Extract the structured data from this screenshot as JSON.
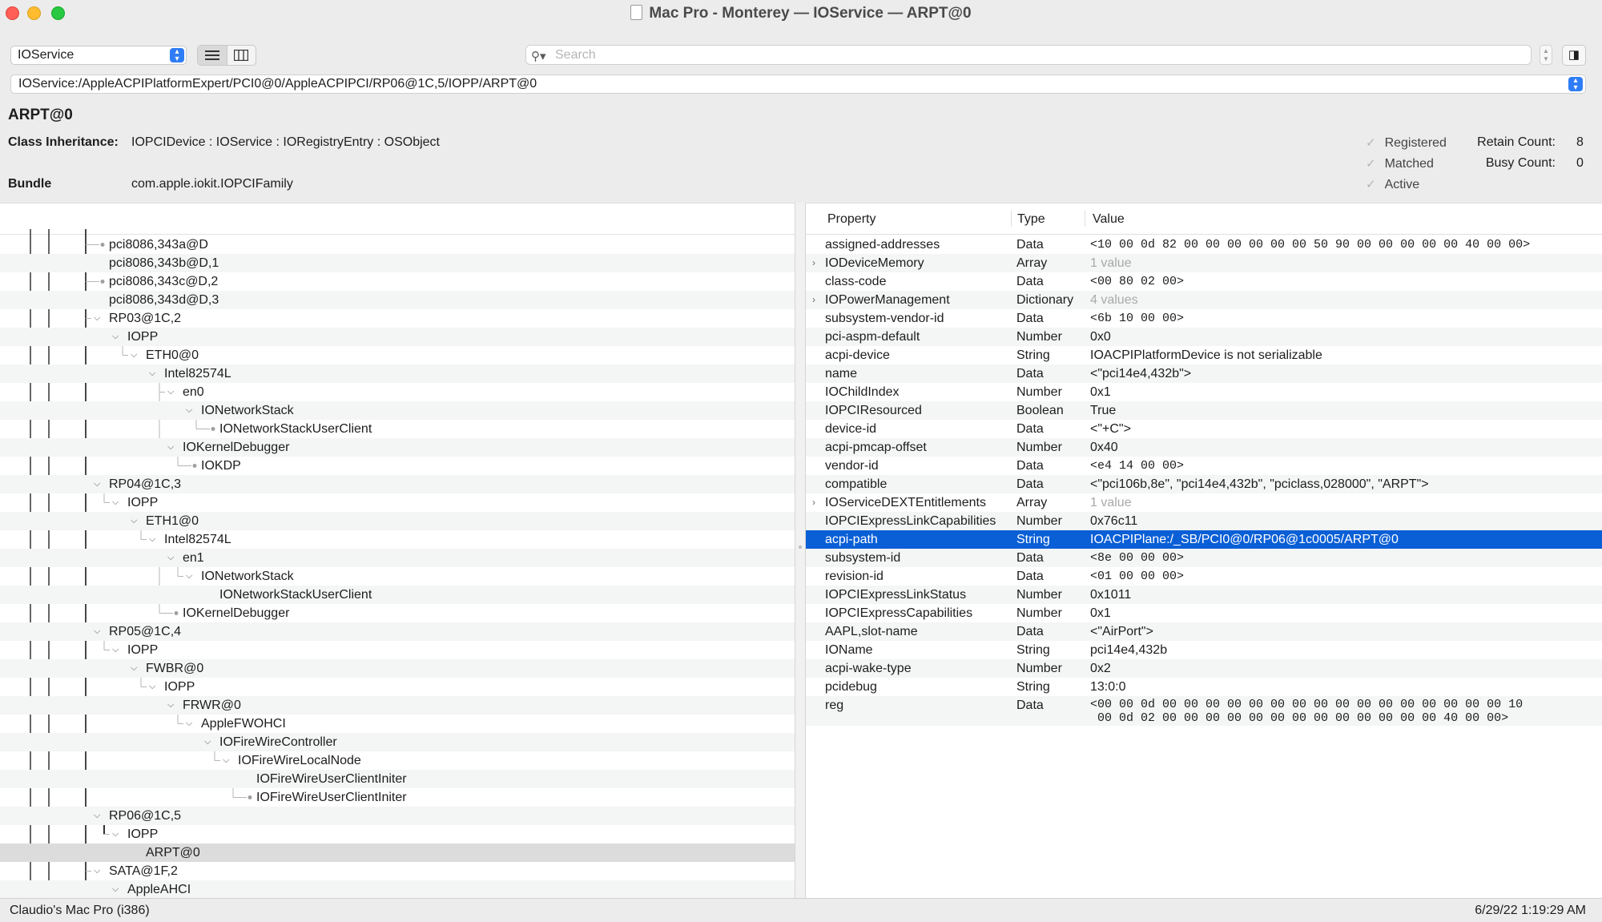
{
  "window": {
    "title": "Mac Pro - Monterey — IOService — ARPT@0"
  },
  "toolbar": {
    "plane": "IOService",
    "search_placeholder": "Search",
    "path": "IOService:/AppleACPIPlatformExpert/PCI0@0/AppleACPIPCI/RP06@1C,5/IOPP/ARPT@0"
  },
  "header": {
    "name": "ARPT@0",
    "class_label": "Class Inheritance:",
    "class_value": "IOPCIDevice : IOService : IORegistryEntry : OSObject",
    "bundle_label": "Bundle",
    "bundle_value": "com.apple.iokit.IOPCIFamily",
    "states": [
      "Registered",
      "Matched",
      "Active"
    ],
    "retain_label": "Retain Count:",
    "retain_value": "8",
    "busy_label": "Busy Count:",
    "busy_value": "0"
  },
  "tree": [
    {
      "label": "pci8086,343a@D",
      "depth": 0,
      "chev": false
    },
    {
      "label": "pci8086,343b@D,1",
      "depth": 0,
      "chev": false
    },
    {
      "label": "pci8086,343c@D,2",
      "depth": 0,
      "chev": false
    },
    {
      "label": "pci8086,343d@D,3",
      "depth": 0,
      "chev": false
    },
    {
      "label": "RP03@1C,2",
      "depth": 0,
      "chev": true
    },
    {
      "label": "IOPP",
      "depth": 1,
      "chev": true
    },
    {
      "label": "ETH0@0",
      "depth": 2,
      "chev": true
    },
    {
      "label": "Intel82574L",
      "depth": 3,
      "chev": true
    },
    {
      "label": "en0",
      "depth": 4,
      "chev": true
    },
    {
      "label": "IONetworkStack",
      "depth": 5,
      "chev": true
    },
    {
      "label": "IONetworkStackUserClient",
      "depth": 6,
      "chev": false
    },
    {
      "label": "IOKernelDebugger",
      "depth": 4,
      "chev": true
    },
    {
      "label": "IOKDP",
      "depth": 5,
      "chev": false
    },
    {
      "label": "RP04@1C,3",
      "depth": 0,
      "chev": true
    },
    {
      "label": "IOPP",
      "depth": 1,
      "chev": true
    },
    {
      "label": "ETH1@0",
      "depth": 2,
      "chev": true
    },
    {
      "label": "Intel82574L",
      "depth": 3,
      "chev": true
    },
    {
      "label": "en1",
      "depth": 4,
      "chev": true
    },
    {
      "label": "IONetworkStack",
      "depth": 5,
      "chev": true
    },
    {
      "label": "IONetworkStackUserClient",
      "depth": 6,
      "chev": false
    },
    {
      "label": "IOKernelDebugger",
      "depth": 4,
      "chev": false
    },
    {
      "label": "RP05@1C,4",
      "depth": 0,
      "chev": true
    },
    {
      "label": "IOPP",
      "depth": 1,
      "chev": true
    },
    {
      "label": "FWBR@0",
      "depth": 2,
      "chev": true
    },
    {
      "label": "IOPP",
      "depth": 3,
      "chev": true
    },
    {
      "label": "FRWR@0",
      "depth": 4,
      "chev": true
    },
    {
      "label": "AppleFWOHCI",
      "depth": 5,
      "chev": true
    },
    {
      "label": "IOFireWireController",
      "depth": 6,
      "chev": true
    },
    {
      "label": "IOFireWireLocalNode",
      "depth": 7,
      "chev": true
    },
    {
      "label": "IOFireWireUserClientIniter",
      "depth": 8,
      "chev": false
    },
    {
      "label": "IOFireWireUserClientIniter",
      "depth": 8,
      "chev": false
    },
    {
      "label": "RP06@1C,5",
      "depth": 0,
      "chev": true
    },
    {
      "label": "IOPP",
      "depth": 1,
      "chev": true
    },
    {
      "label": "ARPT@0",
      "depth": 2,
      "chev": false,
      "selected": true
    },
    {
      "label": "SATA@1F,2",
      "depth": 0,
      "chev": true
    },
    {
      "label": "AppleAHCI",
      "depth": 1,
      "chev": true
    }
  ],
  "properties": {
    "headers": [
      "Property",
      "Type",
      "Value"
    ],
    "rows": [
      {
        "property": "assigned-addresses",
        "type": "Data",
        "value": "<10 00 0d 82 00 00 00 00 00 00 50 90 00 00 00 00 00 40 00 00>",
        "mono": true
      },
      {
        "property": "IODeviceMemory",
        "type": "Array",
        "value": "1 value",
        "expand": true,
        "dim": true
      },
      {
        "property": "class-code",
        "type": "Data",
        "value": "<00 80 02 00>",
        "mono": true
      },
      {
        "property": "IOPowerManagement",
        "type": "Dictionary",
        "value": "4 values",
        "expand": true,
        "dim": true
      },
      {
        "property": "subsystem-vendor-id",
        "type": "Data",
        "value": "<6b 10 00 00>",
        "mono": true
      },
      {
        "property": "pci-aspm-default",
        "type": "Number",
        "value": "0x0"
      },
      {
        "property": "acpi-device",
        "type": "String",
        "value": "IOACPIPlatformDevice is not serializable"
      },
      {
        "property": "name",
        "type": "Data",
        "value": "<\"pci14e4,432b\">"
      },
      {
        "property": "IOChildIndex",
        "type": "Number",
        "value": "0x1"
      },
      {
        "property": "IOPCIResourced",
        "type": "Boolean",
        "value": "True"
      },
      {
        "property": "device-id",
        "type": "Data",
        "value": "<\"+C\">"
      },
      {
        "property": "acpi-pmcap-offset",
        "type": "Number",
        "value": "0x40"
      },
      {
        "property": "vendor-id",
        "type": "Data",
        "value": "<e4 14 00 00>",
        "mono": true
      },
      {
        "property": "compatible",
        "type": "Data",
        "value": "<\"pci106b,8e\", \"pci14e4,432b\", \"pciclass,028000\", \"ARPT\">"
      },
      {
        "property": "IOServiceDEXTEntitlements",
        "type": "Array",
        "value": "1 value",
        "expand": true,
        "dim": true
      },
      {
        "property": "IOPCIExpressLinkCapabilities",
        "type": "Number",
        "value": "0x76c11"
      },
      {
        "property": "acpi-path",
        "type": "String",
        "value": "IOACPIPlane:/_SB/PCI0@0/RP06@1c0005/ARPT@0",
        "selected": true
      },
      {
        "property": "subsystem-id",
        "type": "Data",
        "value": "<8e 00 00 00>",
        "mono": true
      },
      {
        "property": "revision-id",
        "type": "Data",
        "value": "<01 00 00 00>",
        "mono": true
      },
      {
        "property": "IOPCIExpressLinkStatus",
        "type": "Number",
        "value": "0x1011"
      },
      {
        "property": "IOPCIExpressCapabilities",
        "type": "Number",
        "value": "0x1"
      },
      {
        "property": "AAPL,slot-name",
        "type": "Data",
        "value": "<\"AirPort\">"
      },
      {
        "property": "IOName",
        "type": "String",
        "value": "pci14e4,432b"
      },
      {
        "property": "acpi-wake-type",
        "type": "Number",
        "value": "0x2"
      },
      {
        "property": "pcidebug",
        "type": "String",
        "value": "13:0:0"
      },
      {
        "property": "reg",
        "type": "Data",
        "value": "<00 00 0d 00 00 00 00 00 00 00 00 00 00 00 00 00 00 00 00 10",
        "value2": " 00 0d 02 00 00 00 00 00 00 00 00 00 00 00 00 00 40 00 00>",
        "mono": true
      }
    ]
  },
  "status": {
    "machine": "Claudio's Mac Pro (i386)",
    "timestamp": "6/29/22 1:19:29 AM"
  }
}
